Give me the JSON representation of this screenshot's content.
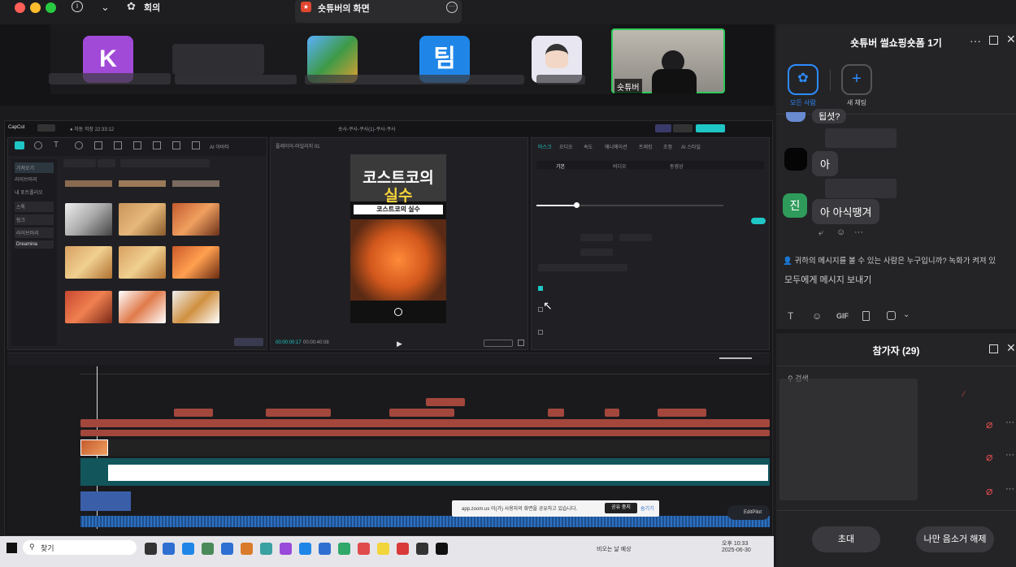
{
  "zoom": {
    "meeting_label": "회의",
    "share_tab_label": "숏튜버의 화면",
    "self_view_name": "숏튜버",
    "thumb_letter": "K",
    "thumb_team": "팀",
    "chat_title": "숏튜버 썰쇼핑숏폼 1기",
    "tab_everyone": "모든 사람",
    "tab_new_chat": "새 채팅",
    "messages": [
      {
        "text": "됩셧?"
      },
      {
        "text": "아"
      },
      {
        "avatar": "진",
        "text": "아 아식땡겨"
      }
    ],
    "privacy_notice": "귀하의 메시지를 볼 수 있는 사람은 누구입니까? 녹화가 켜져 있",
    "message_placeholder": "모두에게 메시지 보내기",
    "gif_label": "GIF",
    "participants_title": "참가자 (29)",
    "search_label": "검색",
    "invite_label": "초대",
    "unmute_self_label": "나만 음소거 해제",
    "share_notice": "app.zoom.us 이(가) 사용자의 화면을 공유하고 있습니다.",
    "stop_share_label": "공유 중지",
    "hide_label": "숨기기",
    "colors": {
      "accent": "#2d8cff",
      "muted": "#e04b4b",
      "bg": "#1b1b1d"
    }
  },
  "capcut": {
    "preview_title_line1": "코스트코의",
    "preview_title_line2": "실수",
    "preview_subtitle": "코스트코의 실수",
    "timecode": "00:00:00:17",
    "duration": "00:00:40:08",
    "project_name": "플레이어-마일리지 01",
    "sidebar_items": [
      "가져오기",
      "라이브러리",
      "내 포트폴리오",
      "스톡",
      "링크",
      "라이브러리",
      "Dreamina"
    ],
    "prop_tabs": [
      "기본",
      "비디오",
      "동영상",
      "마스크",
      "오디오",
      "속도",
      "애니메이션",
      "트래킹",
      "조정",
      "AI 스타일"
    ],
    "editpilot": "EditPilot"
  },
  "taskbar": {
    "search": "찾기",
    "weather": "비오는 날 예상",
    "time": "오후 10:33",
    "date": "2025-06-30"
  }
}
